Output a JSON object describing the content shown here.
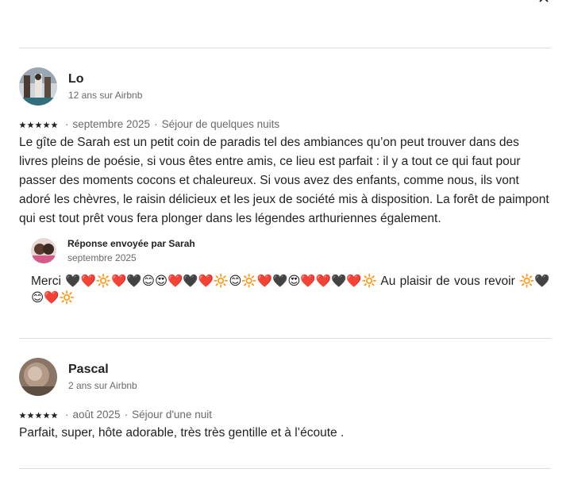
{
  "modal": {
    "close_label": "×"
  },
  "reviews": [
    {
      "name": "Lo",
      "member_since": "12 ans sur Airbnb",
      "rating": 5,
      "date": "septembre 2025",
      "stay": "Séjour de quelques nuits",
      "text": "Le gîte de Sarah est un petit coin de paradis tel des ambiances qu’on peut trouver dans des livres pleins de poésie, si vous êtes entre amis, ce lieu est parfait : il y a tout ce qui faut pour passer des moments cocons et chaleureux. Si vous avez des enfants, comme nous, ils vont adoré les chèvres, le raisin délicieux et les jeux de société mis à disposition. La forêt de paimpont qui est tout prêt vous fera plonger dans les légendes arthuriennes également.",
      "response": {
        "by": "Réponse envoyée par Sarah",
        "date": "septembre 2025",
        "text": "Merci 🖤❤️🔆❤️🖤😊😍❤️🖤❤️🔆😊🔆❤️🖤😍❤️❤️🖤❤️🔆 Au plaisir de vous revoir 🔆🖤😊❤️🔆"
      }
    },
    {
      "name": "Pascal",
      "member_since": "2 ans sur Airbnb",
      "rating": 5,
      "date": "août 2025",
      "stay": "Séjour d'une nuit",
      "text": "Parfait, super, hôte adorable, très très gentille et à l’écoute ."
    }
  ],
  "separator": "·",
  "icons": {
    "close": "close-icon",
    "star": "star-icon",
    "star_color": "#222222"
  }
}
